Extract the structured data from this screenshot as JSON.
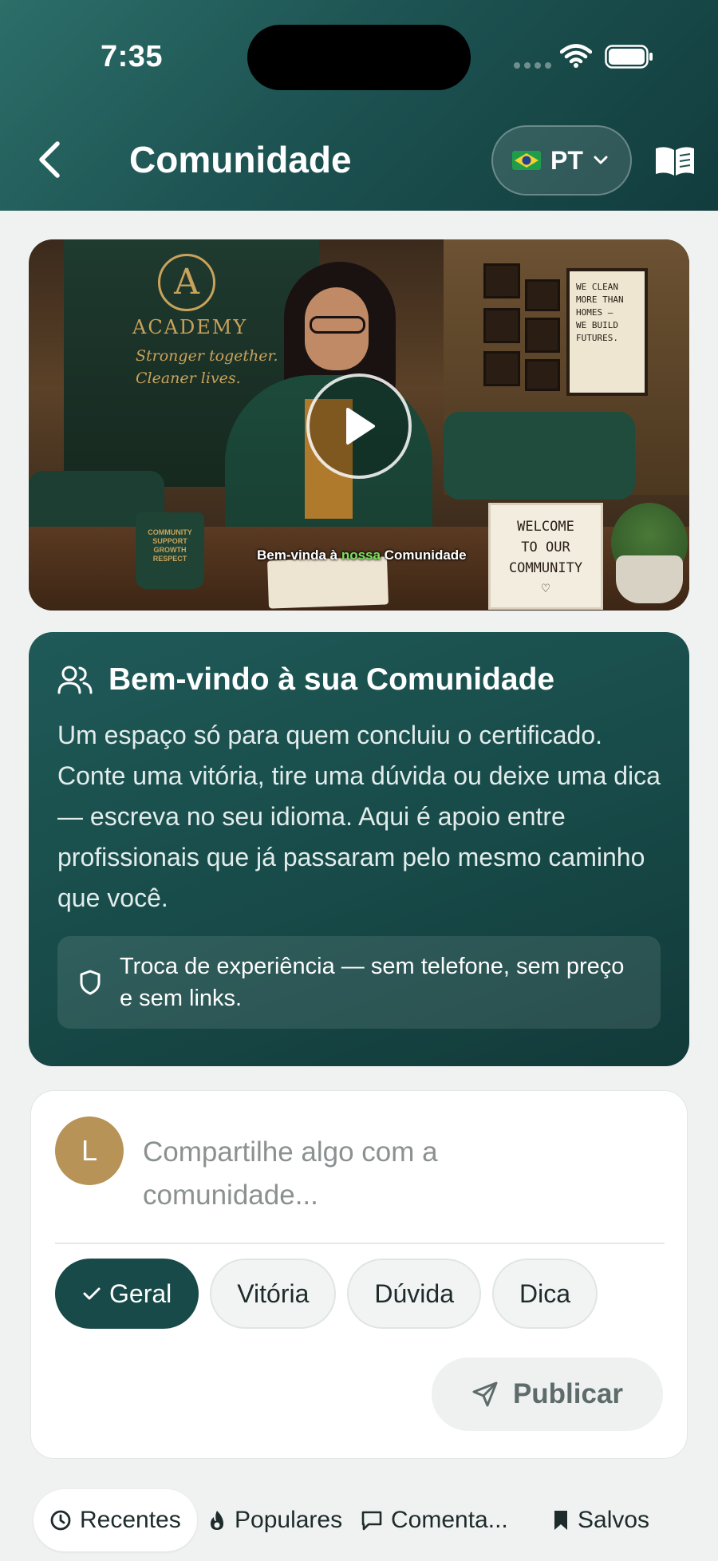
{
  "status_bar": {
    "time": "7:35"
  },
  "header": {
    "title": "Comunidade",
    "language": {
      "code": "PT",
      "flag_icon": "brazil-flag-icon"
    },
    "back_icon": "chevron-left-icon",
    "guide_icon": "open-book-icon"
  },
  "video": {
    "caption_parts": [
      "Bem-vinda à ",
      "nossa",
      " Comunidade"
    ],
    "scene_text": {
      "logo_letter": "A",
      "academy": "ACADEMY",
      "tagline": "Stronger together. Cleaner lives.",
      "poster": [
        "WE CLEAN",
        "MORE THAN",
        "HOMES —",
        "WE BUILD",
        "FUTURES."
      ],
      "mug": [
        "COMMUNITY",
        "SUPPORT",
        "GROWTH",
        "RESPECT"
      ],
      "sign": [
        "WELCOME",
        "TO OUR",
        "COMMUNITY"
      ]
    },
    "play_icon": "play-icon"
  },
  "welcome": {
    "title": "Bem-vindo à sua Comunidade",
    "text": "Um espaço só para quem concluiu o certificado. Conte uma vitória, tire uma dúvida ou deixe uma dica — escreva no seu idioma. Aqui é apoio entre profissionais que já passaram pelo mesmo caminho que você.",
    "rule": "Troca de experiência — sem telefone, sem preço e sem links."
  },
  "composer": {
    "avatar_initial": "L",
    "placeholder": "Compartilhe algo com a comunidade...",
    "chips": [
      {
        "label": "Geral",
        "active": true
      },
      {
        "label": "Vitória",
        "active": false
      },
      {
        "label": "Dúvida",
        "active": false
      },
      {
        "label": "Dica",
        "active": false
      }
    ],
    "publish_label": "Publicar"
  },
  "tabs": [
    {
      "label": "Recentes",
      "icon": "clock-icon",
      "active": true
    },
    {
      "label": "Populares",
      "icon": "flame-icon",
      "active": false
    },
    {
      "label": "Comenta...",
      "icon": "comment-icon",
      "active": false
    },
    {
      "label": "Salvos",
      "icon": "bookmark-icon",
      "active": false
    }
  ],
  "colors": {
    "header": "#1d5352",
    "accent": "#174a48",
    "avatar": "#b79357",
    "background": "#f0f2f1"
  }
}
